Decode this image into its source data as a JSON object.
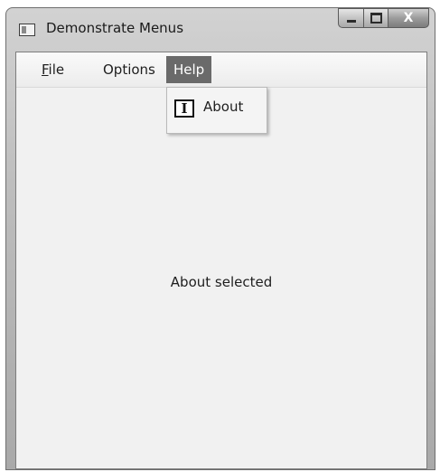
{
  "window": {
    "title": "Demonstrate Menus",
    "controls": {
      "minimize_icon": "minimize-icon",
      "maximize_icon": "maximize-icon",
      "close_glyph": "X"
    }
  },
  "menubar": {
    "items": [
      {
        "accel": "F",
        "rest": "ile"
      },
      {
        "label": "Options"
      },
      {
        "label": "Help"
      }
    ]
  },
  "help_menu": {
    "items": [
      {
        "label": "About",
        "icon": "about-icon",
        "icon_glyph": "I"
      }
    ]
  },
  "content": {
    "status_text": "About selected"
  }
}
